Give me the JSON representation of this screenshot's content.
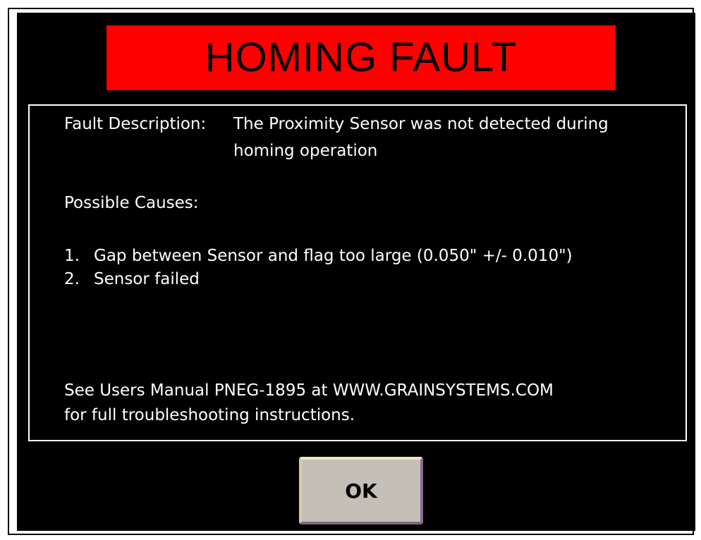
{
  "title": "HOMING FAULT",
  "fault_description": {
    "label": "Fault Description:",
    "line1": "The Proximity Sensor was not detected during",
    "line2": "homing operation"
  },
  "possible_causes": {
    "heading": "Possible Causes:",
    "items": [
      {
        "number": "1.",
        "text": "Gap between Sensor and flag too large  (0.050\" +/- 0.010\")"
      },
      {
        "number": "2.",
        "text": "Sensor failed"
      }
    ]
  },
  "manual_reference": {
    "line1": "See Users Manual PNEG-1895 at WWW.GRAINSYSTEMS.COM",
    "line2": "for full troubleshooting instructions."
  },
  "ok_button": {
    "label": "OK"
  },
  "colors": {
    "banner": "#ff0000",
    "background": "#000000",
    "text": "#ffffff",
    "button_face": "#c4c0b8"
  }
}
